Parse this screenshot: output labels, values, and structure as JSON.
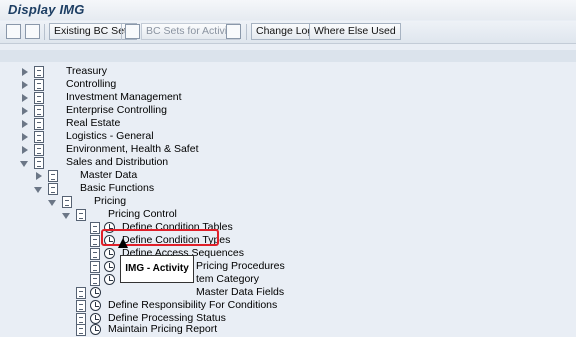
{
  "window": {
    "title": "Display IMG"
  },
  "toolbar": {
    "existing_bc_sets": "Existing BC Sets",
    "bc_sets_for_activity": "BC Sets for Activity",
    "change_log": "Change Log",
    "where_else_used": "Where Else Used"
  },
  "tree": {
    "items": [
      {
        "label": "Treasury"
      },
      {
        "label": "Controlling"
      },
      {
        "label": "Investment Management"
      },
      {
        "label": "Enterprise Controlling"
      },
      {
        "label": "Real Estate"
      },
      {
        "label": "Logistics - General"
      },
      {
        "label": "Environment, Health & Safet"
      },
      {
        "label": "Sales and Distribution"
      },
      {
        "label": "Master Data"
      },
      {
        "label": "Basic Functions"
      },
      {
        "label": "Pricing"
      },
      {
        "label": "Pricing Control"
      },
      {
        "label": "Define Condition Tables"
      },
      {
        "label": "Define Condition Types"
      },
      {
        "label": "Define Access Sequences"
      },
      {
        "label": "Pricing Procedures"
      },
      {
        "label": "tem Category"
      },
      {
        "label": "Master Data Fields"
      },
      {
        "label": "Define Responsibility For Conditions"
      },
      {
        "label": "Define Processing Status"
      },
      {
        "label": "Maintain Pricing Report"
      }
    ]
  },
  "tooltip": {
    "text": "IMG - Activity"
  }
}
